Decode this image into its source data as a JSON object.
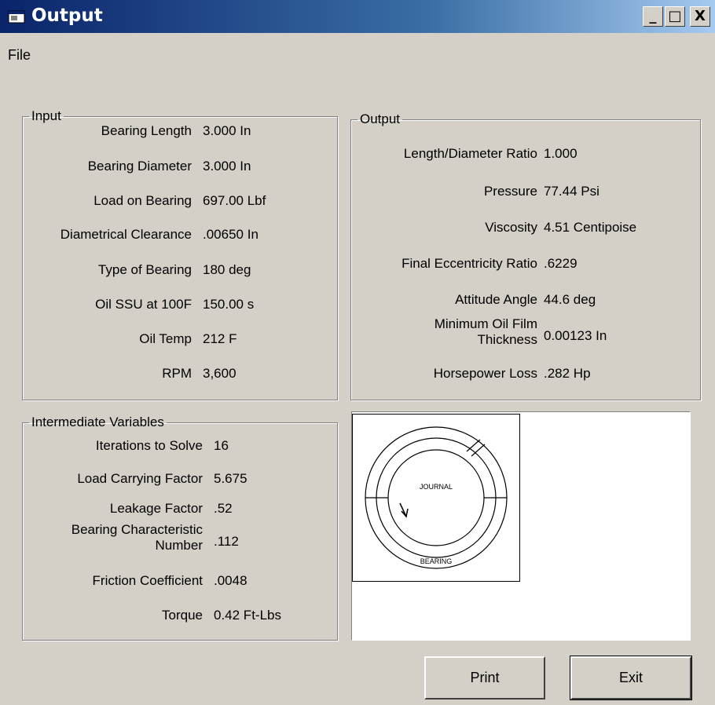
{
  "window": {
    "title": "Output",
    "minimize": "_",
    "maximize": "□",
    "close": "X"
  },
  "menu": {
    "file": "File"
  },
  "input": {
    "legend": "Input",
    "rows": [
      {
        "label": "Bearing Length",
        "value": "3.000 In"
      },
      {
        "label": "Bearing Diameter",
        "value": "3.000 In"
      },
      {
        "label": "Load on Bearing",
        "value": "697.00 Lbf"
      },
      {
        "label": "Diametrical Clearance",
        "value": ".00650 In"
      },
      {
        "label": "Type of Bearing",
        "value": "180 deg"
      },
      {
        "label": "Oil SSU at 100F",
        "value": "150.00 s"
      },
      {
        "label": "Oil Temp",
        "value": "212 F"
      },
      {
        "label": "RPM",
        "value": "3,600"
      }
    ]
  },
  "output": {
    "legend": "Output",
    "rows": [
      {
        "label": "Length/Diameter Ratio",
        "value": "1.000"
      },
      {
        "label": "Pressure",
        "value": "77.44 Psi"
      },
      {
        "label": "Viscosity",
        "value": "4.51 Centipoise"
      },
      {
        "label": "Final Eccentricity Ratio",
        "value": ".6229"
      },
      {
        "label": "Attitude Angle",
        "value": "44.6 deg"
      },
      {
        "label": "Minimum Oil Film Thickness",
        "value": "0.00123 In"
      },
      {
        "label": "Horsepower Loss",
        "value": ".282 Hp"
      }
    ]
  },
  "intermediate": {
    "legend": "Intermediate Variables",
    "rows": [
      {
        "label": "Iterations to Solve",
        "value": "16"
      },
      {
        "label": "Load Carrying Factor",
        "value": "5.675"
      },
      {
        "label": "Leakage Factor",
        "value": ".52"
      },
      {
        "label": "Bearing Characteristic Number",
        "value": ".112"
      },
      {
        "label": "Friction Coefficient",
        "value": ".0048"
      },
      {
        "label": "Torque",
        "value": "0.42 Ft-Lbs"
      }
    ]
  },
  "diagram": {
    "journal_label": "JOURNAL",
    "bearing_label": "BEARING"
  },
  "buttons": {
    "print": "Print",
    "exit": "Exit"
  }
}
